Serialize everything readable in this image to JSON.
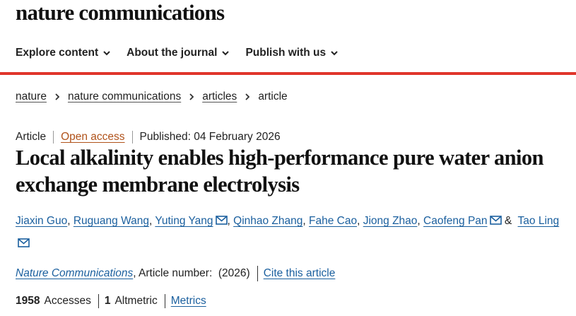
{
  "site": {
    "logo": "nature communications"
  },
  "nav": [
    {
      "label": "Explore content"
    },
    {
      "label": "About the journal"
    },
    {
      "label": "Publish with us"
    }
  ],
  "breadcrumb": [
    "nature",
    "nature communications",
    "articles",
    "article"
  ],
  "article": {
    "type": "Article",
    "access": "Open access",
    "published": "Published: 04 February 2026",
    "title": "Local alkalinity enables high-performance pure water anion exchange membrane electrolysis",
    "authors": [
      {
        "name": "Jiaxin Guo",
        "sep": ", "
      },
      {
        "name": "Ruguang Wang",
        "sep": ", "
      },
      {
        "name": "Yuting Yang",
        "sep": ", "
      },
      {
        "name": "Qinhao Zhang",
        "sep": ", "
      },
      {
        "name": "Fahe Cao",
        "sep": ", "
      },
      {
        "name": "Jiong Zhao",
        "sep": ", "
      },
      {
        "name": "Caofeng Pan",
        "sep": " & "
      },
      {
        "name": "Tao Ling",
        "sep": ""
      }
    ],
    "journal": "Nature Communications",
    "article_number": ", Article number:  (2026)",
    "cite": "Cite this article",
    "accesses_count": "1958",
    "accesses_label": "Accesses",
    "altmetric_count": "1",
    "altmetric_label": "Altmetric",
    "metrics_link": "Metrics"
  },
  "colors": {
    "accent_bar": "#e0352b",
    "link": "#1a5f9e",
    "open_access": "#b0521a"
  },
  "icons": {
    "nav_chevron": "chevron-down-icon",
    "breadcrumb_sep": "chevron-right-icon",
    "email": "mail-icon"
  }
}
